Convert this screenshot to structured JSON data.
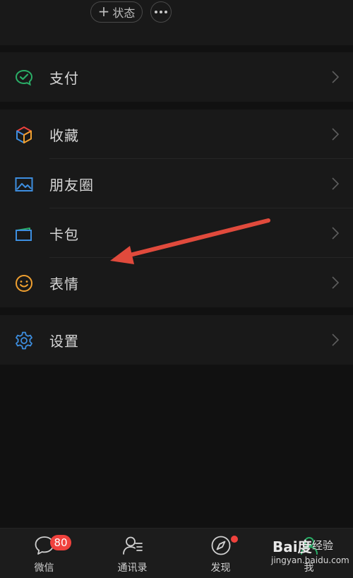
{
  "header": {
    "status_label": "状态",
    "plus": "+"
  },
  "menu": {
    "pay": "支付",
    "favorites": "收藏",
    "moments": "朋友圈",
    "cards": "卡包",
    "stickers": "表情",
    "settings": "设置"
  },
  "tabbar": {
    "chats": {
      "label": "微信",
      "badge": "80"
    },
    "contacts": {
      "label": "通讯录"
    },
    "discover": {
      "label": "发现"
    },
    "me": {
      "label": "我"
    }
  },
  "watermark": {
    "brand": "Bai度",
    "jingyan": "经验",
    "url": "jingyan.baidu.com"
  },
  "colors": {
    "background": "#111111",
    "panel": "#191919",
    "text": "#d6d6d6",
    "badge": "#f0423d",
    "arrow": "#e04a3c",
    "pay_green": "#2aae67",
    "blue": "#3d8ee0",
    "orange": "#f0a030"
  }
}
